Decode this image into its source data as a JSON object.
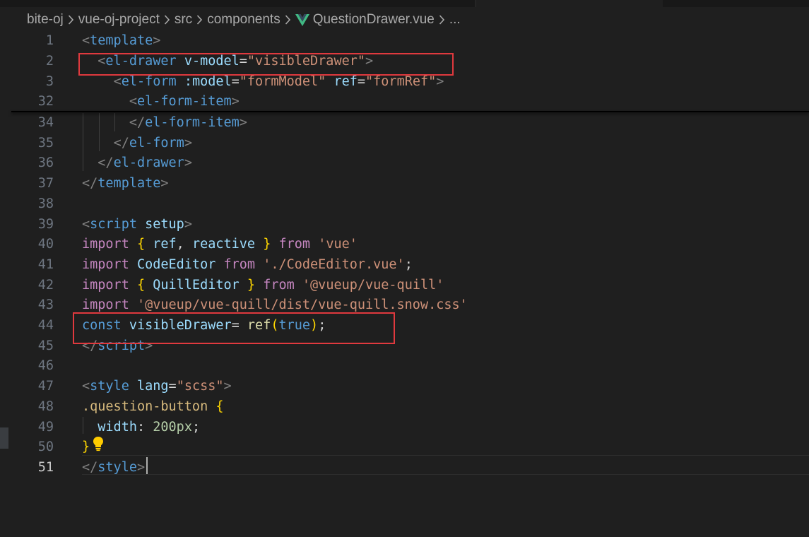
{
  "breadcrumb": {
    "items": [
      "bite-oj",
      "vue-oj-project",
      "src",
      "components",
      "QuestionDrawer.vue",
      "..."
    ],
    "file_icon": "vue-icon"
  },
  "editor": {
    "lines": [
      {
        "n": "1",
        "parts": [
          [
            "punct",
            "<"
          ],
          [
            "tag",
            "template"
          ],
          [
            "punct",
            ">"
          ]
        ]
      },
      {
        "n": "2",
        "parts": [
          [
            "plain",
            "  "
          ],
          [
            "punct",
            "<"
          ],
          [
            "tag",
            "el-drawer"
          ],
          [
            "plain",
            " "
          ],
          [
            "attr",
            "v-model"
          ],
          [
            "plain",
            "="
          ],
          [
            "str",
            "\"visibleDrawer\""
          ],
          [
            "punct",
            ">"
          ]
        ]
      },
      {
        "n": "3",
        "parts": [
          [
            "plain",
            "    "
          ],
          [
            "punct",
            "<"
          ],
          [
            "tag",
            "el-form"
          ],
          [
            "plain",
            " "
          ],
          [
            "attr",
            ":model"
          ],
          [
            "plain",
            "="
          ],
          [
            "str",
            "\"formModel\""
          ],
          [
            "plain",
            " "
          ],
          [
            "attr",
            "ref"
          ],
          [
            "plain",
            "="
          ],
          [
            "str",
            "\"formRef\""
          ],
          [
            "punct",
            ">"
          ]
        ]
      },
      {
        "n": "32",
        "parts": [
          [
            "plain",
            "      "
          ],
          [
            "punct",
            "<"
          ],
          [
            "tag",
            "el-form-item"
          ],
          [
            "punct",
            ">"
          ]
        ]
      },
      {
        "n": "34",
        "parts": [
          [
            "plain",
            "      "
          ],
          [
            "punct",
            "</"
          ],
          [
            "tag",
            "el-form-item"
          ],
          [
            "punct",
            ">"
          ]
        ]
      },
      {
        "n": "35",
        "parts": [
          [
            "plain",
            "    "
          ],
          [
            "punct",
            "</"
          ],
          [
            "tag",
            "el-form"
          ],
          [
            "punct",
            ">"
          ]
        ]
      },
      {
        "n": "36",
        "parts": [
          [
            "plain",
            "  "
          ],
          [
            "punct",
            "</"
          ],
          [
            "tag",
            "el-drawer"
          ],
          [
            "punct",
            ">"
          ]
        ]
      },
      {
        "n": "37",
        "parts": [
          [
            "punct",
            "</"
          ],
          [
            "tag",
            "template"
          ],
          [
            "punct",
            ">"
          ]
        ]
      },
      {
        "n": "38",
        "parts": []
      },
      {
        "n": "39",
        "parts": [
          [
            "punct",
            "<"
          ],
          [
            "tag",
            "script"
          ],
          [
            "plain",
            " "
          ],
          [
            "attr",
            "setup"
          ],
          [
            "punct",
            ">"
          ]
        ]
      },
      {
        "n": "40",
        "parts": [
          [
            "kw",
            "import"
          ],
          [
            "plain",
            " "
          ],
          [
            "brace",
            "{"
          ],
          [
            "plain",
            " "
          ],
          [
            "var",
            "ref"
          ],
          [
            "plain",
            ", "
          ],
          [
            "attr",
            "reactive"
          ],
          [
            "plain",
            " "
          ],
          [
            "brace",
            "}"
          ],
          [
            "plain",
            " "
          ],
          [
            "kw",
            "from"
          ],
          [
            "plain",
            " "
          ],
          [
            "str",
            "'vue'"
          ]
        ]
      },
      {
        "n": "41",
        "parts": [
          [
            "kw",
            "import"
          ],
          [
            "plain",
            " "
          ],
          [
            "var",
            "CodeEditor"
          ],
          [
            "plain",
            " "
          ],
          [
            "kw",
            "from"
          ],
          [
            "plain",
            " "
          ],
          [
            "str",
            "'./CodeEditor.vue'"
          ],
          [
            "plain",
            ";"
          ]
        ]
      },
      {
        "n": "42",
        "parts": [
          [
            "kw",
            "import"
          ],
          [
            "plain",
            " "
          ],
          [
            "brace",
            "{"
          ],
          [
            "plain",
            " "
          ],
          [
            "var",
            "QuillEditor"
          ],
          [
            "plain",
            " "
          ],
          [
            "brace",
            "}"
          ],
          [
            "plain",
            " "
          ],
          [
            "kw",
            "from"
          ],
          [
            "plain",
            " "
          ],
          [
            "str",
            "'@vueup/vue-quill'"
          ]
        ]
      },
      {
        "n": "43",
        "parts": [
          [
            "kw",
            "import"
          ],
          [
            "plain",
            " "
          ],
          [
            "str",
            "'@vueup/vue-quill/dist/vue-quill.snow.css'"
          ]
        ]
      },
      {
        "n": "44",
        "parts": [
          [
            "kwblue",
            "const"
          ],
          [
            "plain",
            " "
          ],
          [
            "var",
            "visibleDrawer"
          ],
          [
            "plain",
            "= "
          ],
          [
            "func",
            "ref"
          ],
          [
            "brace",
            "("
          ],
          [
            "kwblue",
            "true"
          ],
          [
            "brace",
            ")"
          ],
          [
            "plain",
            ";"
          ]
        ]
      },
      {
        "n": "45",
        "parts": [
          [
            "punct",
            "</"
          ],
          [
            "tag",
            "script"
          ],
          [
            "punct",
            ">"
          ]
        ]
      },
      {
        "n": "46",
        "parts": []
      },
      {
        "n": "47",
        "parts": [
          [
            "punct",
            "<"
          ],
          [
            "tag",
            "style"
          ],
          [
            "plain",
            " "
          ],
          [
            "attr",
            "lang"
          ],
          [
            "plain",
            "="
          ],
          [
            "str",
            "\"scss\""
          ],
          [
            "punct",
            ">"
          ]
        ]
      },
      {
        "n": "48",
        "parts": [
          [
            "sel",
            ".question-button"
          ],
          [
            "plain",
            " "
          ],
          [
            "brace",
            "{"
          ]
        ]
      },
      {
        "n": "49",
        "parts": [
          [
            "plain",
            "  "
          ],
          [
            "attr",
            "width"
          ],
          [
            "plain",
            ": "
          ],
          [
            "num-lit",
            "200px"
          ],
          [
            "plain",
            ";"
          ]
        ]
      },
      {
        "n": "50",
        "parts": [
          [
            "brace",
            "}"
          ]
        ]
      },
      {
        "n": "51",
        "parts": [
          [
            "punct",
            "</"
          ],
          [
            "tag",
            "style"
          ],
          [
            "punct",
            ">"
          ]
        ],
        "active": true
      }
    ]
  },
  "icons": {
    "lightbulb": "lightbulb-icon",
    "separator": "chevron-right-icon"
  },
  "colors": {
    "background": "#1f1f1f",
    "highlight_box": "#e0393e",
    "tag": "#569cd6",
    "string": "#ce9178",
    "attribute": "#9cdcfe",
    "keyword": "#c586c0"
  }
}
